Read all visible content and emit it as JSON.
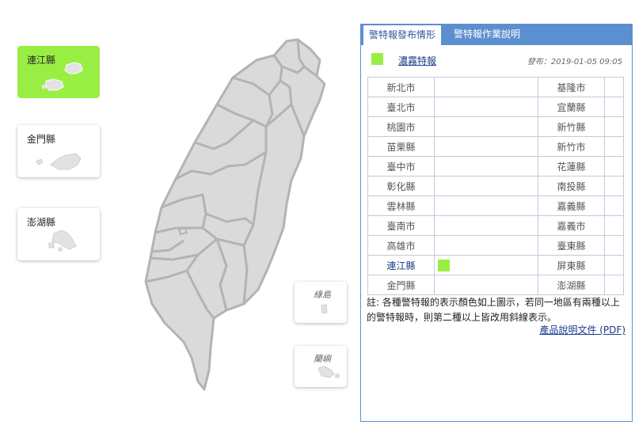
{
  "islands": {
    "lienchiang": {
      "label": "連江縣",
      "active": true
    },
    "kinmen": {
      "label": "金門縣",
      "active": false
    },
    "penghu": {
      "label": "澎湖縣",
      "active": false
    },
    "green_island": {
      "label": "綠島"
    },
    "orchid_island": {
      "label": "蘭嶼"
    }
  },
  "tabs": [
    {
      "label": "警特報發布情形",
      "active": true
    },
    {
      "label": "警特報作業說明",
      "active": false
    }
  ],
  "legend": {
    "name": "濃霧特報",
    "color": "#99ee44"
  },
  "publish": {
    "label": "發布：2019-01-05 09:05"
  },
  "regions_left": [
    "新北市",
    "臺北市",
    "桃園市",
    "苗栗縣",
    "臺中市",
    "彰化縣",
    "雲林縣",
    "臺南市",
    "高雄市",
    "連江縣",
    "金門縣"
  ],
  "regions_right": [
    "基隆市",
    "宜蘭縣",
    "新竹縣",
    "新竹市",
    "花蓮縣",
    "南投縣",
    "嘉義縣",
    "嘉義市",
    "臺東縣",
    "屏東縣",
    "澎湖縣"
  ],
  "alert_regions": [
    "連江縣"
  ],
  "note": "註: 各種警特報的表示顏色如上圖示，若同一地區有兩種以上的警特報時，則第二種以上皆改用斜線表示。",
  "pdf_link": "產品說明文件 (PDF)",
  "colors": {
    "alert": "#99ee44",
    "tab_bar": "#5c8fcf",
    "land": "#dadada",
    "border": "#b3b3b3"
  }
}
